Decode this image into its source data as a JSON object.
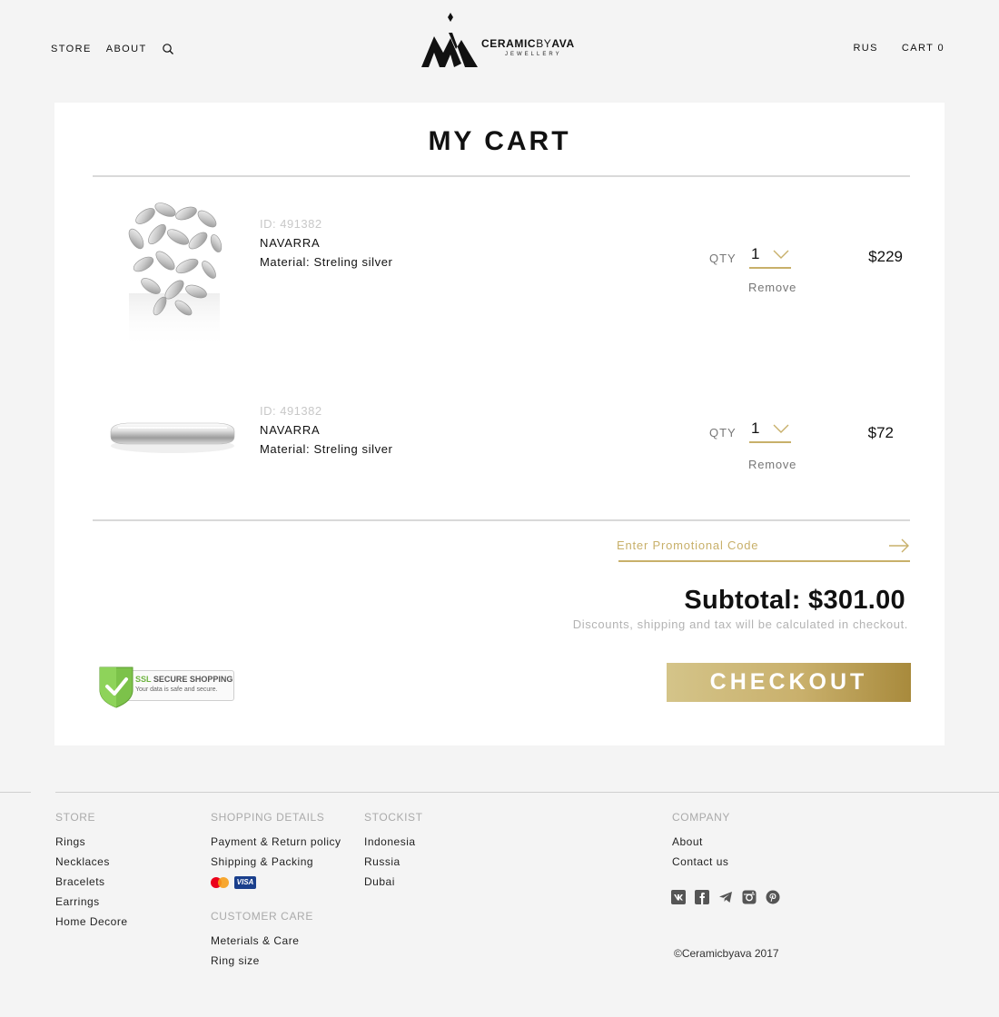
{
  "header": {
    "nav_store": "STORE",
    "nav_about": "ABOUT",
    "lang": "RUS",
    "cart": "CART 0",
    "logo_brand_a": "CERAMIC",
    "logo_brand_b": "BY",
    "logo_brand_c": "AVA",
    "logo_sub": "JEWELLERY"
  },
  "cart": {
    "title": "MY CART",
    "qty_label": "QTY",
    "remove_label": "Remove",
    "items": [
      {
        "id": "ID: 491382",
        "name": "NAVARRA",
        "material": "Material: Streling silver",
        "qty": "1",
        "price": "$229",
        "image": "leaf-ring"
      },
      {
        "id": "ID: 491382",
        "name": "NAVARRA",
        "material": "Material: Streling silver",
        "qty": "1",
        "price": "$72",
        "image": "band-ring"
      }
    ],
    "promo_placeholder": "Enter Promotional Code",
    "subtotal": "Subtotal: $301.00",
    "subtotal_note": "Discounts, shipping and tax will be calculated in checkout.",
    "ssl_title_a": "SSL",
    "ssl_title_b": "SECURE SHOPPING",
    "ssl_sub": "Your data is safe and secure.",
    "checkout": "CHECKOUT"
  },
  "footer": {
    "store_head": "STORE",
    "store_links": [
      "Rings",
      "Necklaces",
      "Bracelets",
      "Earrings",
      "Home Decore"
    ],
    "shipping_head": "SHOPPING DETAILS",
    "shipping_links": [
      "Payment & Return policy",
      "Shipping & Packing"
    ],
    "payment_icons": [
      "mastercard-icon",
      "visa-icon"
    ],
    "visa_text": "VISA",
    "care_head": "CUSTOMER CARE",
    "care_links": [
      "Meterials & Care",
      "Ring size"
    ],
    "stockist_head": "STOCKIST",
    "stockist_links": [
      "Indonesia",
      "Russia",
      "Dubai"
    ],
    "company_head": "COMPANY",
    "company_links": [
      "About",
      "Contact us"
    ],
    "social_icons": [
      "vk-icon",
      "facebook-icon",
      "telegram-icon",
      "instagram-icon",
      "pinterest-icon"
    ],
    "copyright": "©Ceramicbyava 2017"
  },
  "colors": {
    "gold": "#c8b06a",
    "background": "#f4f4f4",
    "card": "#ffffff",
    "muted": "#b3b3b3"
  }
}
